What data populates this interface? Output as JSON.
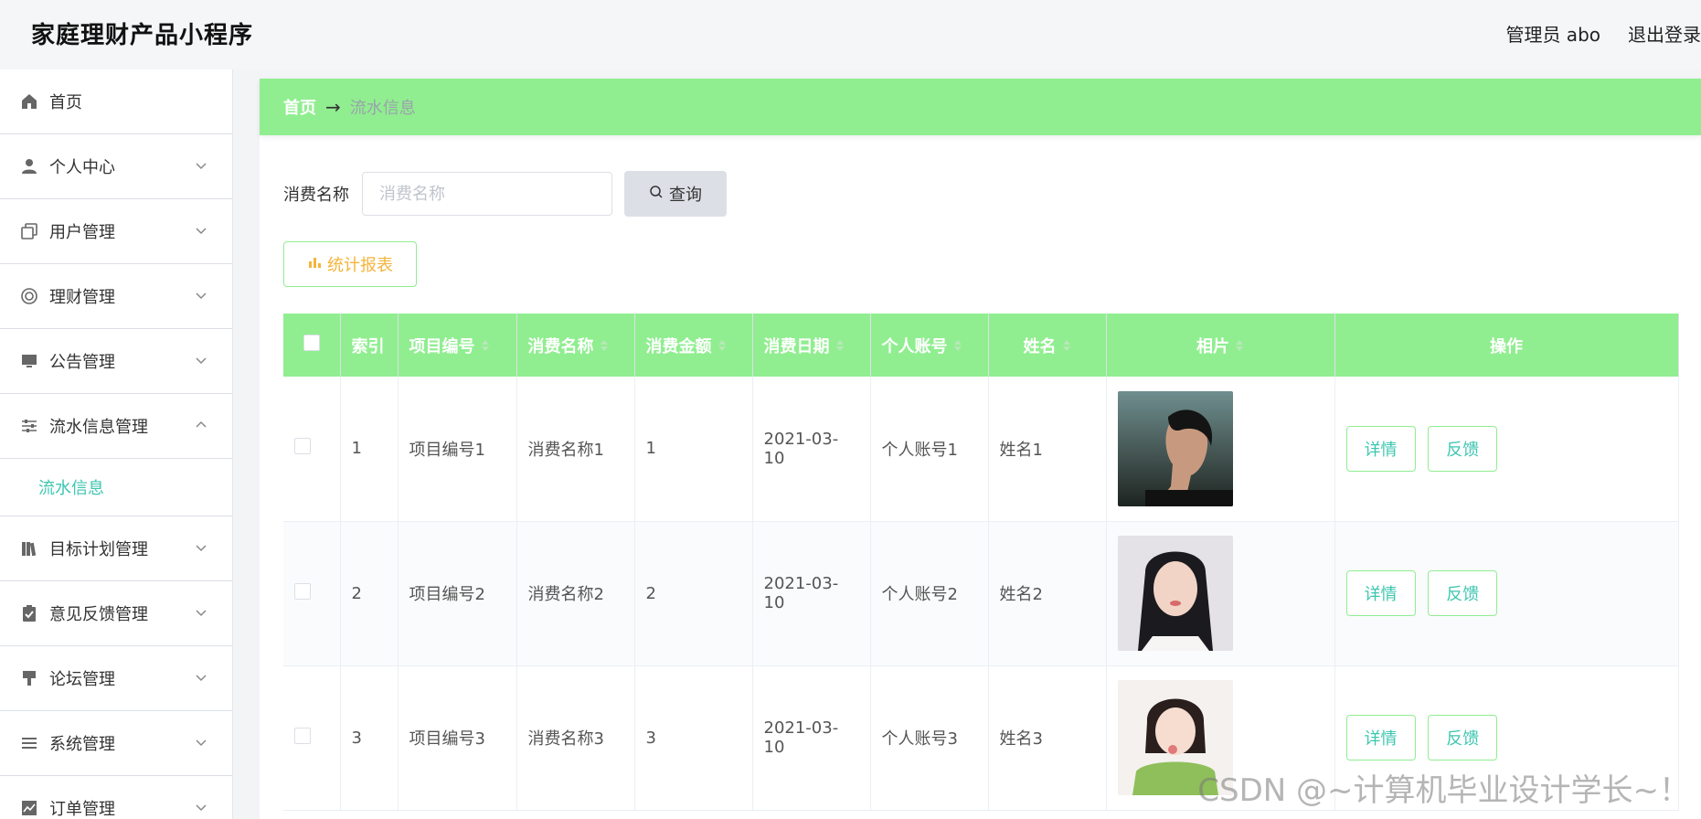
{
  "app": {
    "title": "家庭理财产品小程序"
  },
  "header": {
    "user_label": "管理员 abo",
    "logout_label": "退出登录"
  },
  "sidebar": {
    "items": [
      {
        "label": "首页",
        "icon": "home-icon"
      },
      {
        "label": "个人中心",
        "icon": "user-icon"
      },
      {
        "label": "用户管理",
        "icon": "copy-icon"
      },
      {
        "label": "理财管理",
        "icon": "lifebuoy-icon"
      },
      {
        "label": "公告管理",
        "icon": "monitor-icon"
      },
      {
        "label": "流水信息管理",
        "icon": "sliders-icon",
        "expanded": true
      },
      {
        "label": "目标计划管理",
        "icon": "books-icon"
      },
      {
        "label": "意见反馈管理",
        "icon": "clipboard-check-icon"
      },
      {
        "label": "论坛管理",
        "icon": "pin-icon"
      },
      {
        "label": "系统管理",
        "icon": "lines-icon"
      },
      {
        "label": "订单管理",
        "icon": "chart-icon"
      }
    ],
    "sub_item": {
      "label": "流水信息"
    }
  },
  "breadcrumb": {
    "home": "首页",
    "arrow": "→",
    "current": "流水信息"
  },
  "search": {
    "label": "消费名称",
    "placeholder": "消费名称",
    "value": "",
    "button_label": "查询"
  },
  "report_button": {
    "label": "统计报表"
  },
  "table": {
    "headers": [
      "索引",
      "项目编号",
      "消费名称",
      "消费金额",
      "消费日期",
      "个人账号",
      "姓名",
      "相片",
      "操作"
    ],
    "rows": [
      {
        "index": "1",
        "code": "项目编号1",
        "name": "消费名称1",
        "amount": "1",
        "date": "2021-03-10",
        "account": "个人账号1",
        "person": "姓名1"
      },
      {
        "index": "2",
        "code": "项目编号2",
        "name": "消费名称2",
        "amount": "2",
        "date": "2021-03-10",
        "account": "个人账号2",
        "person": "姓名2"
      },
      {
        "index": "3",
        "code": "项目编号3",
        "name": "消费名称3",
        "amount": "3",
        "date": "2021-03-10",
        "account": "个人账号3",
        "person": "姓名3"
      }
    ],
    "actions": {
      "detail": "详情",
      "feedback": "反馈"
    }
  },
  "colors": {
    "accent": "#90ee90",
    "teal": "#3ec6b0",
    "report": "#f5b43b"
  },
  "watermark": "CSDN @~计算机毕业设计学长~！"
}
